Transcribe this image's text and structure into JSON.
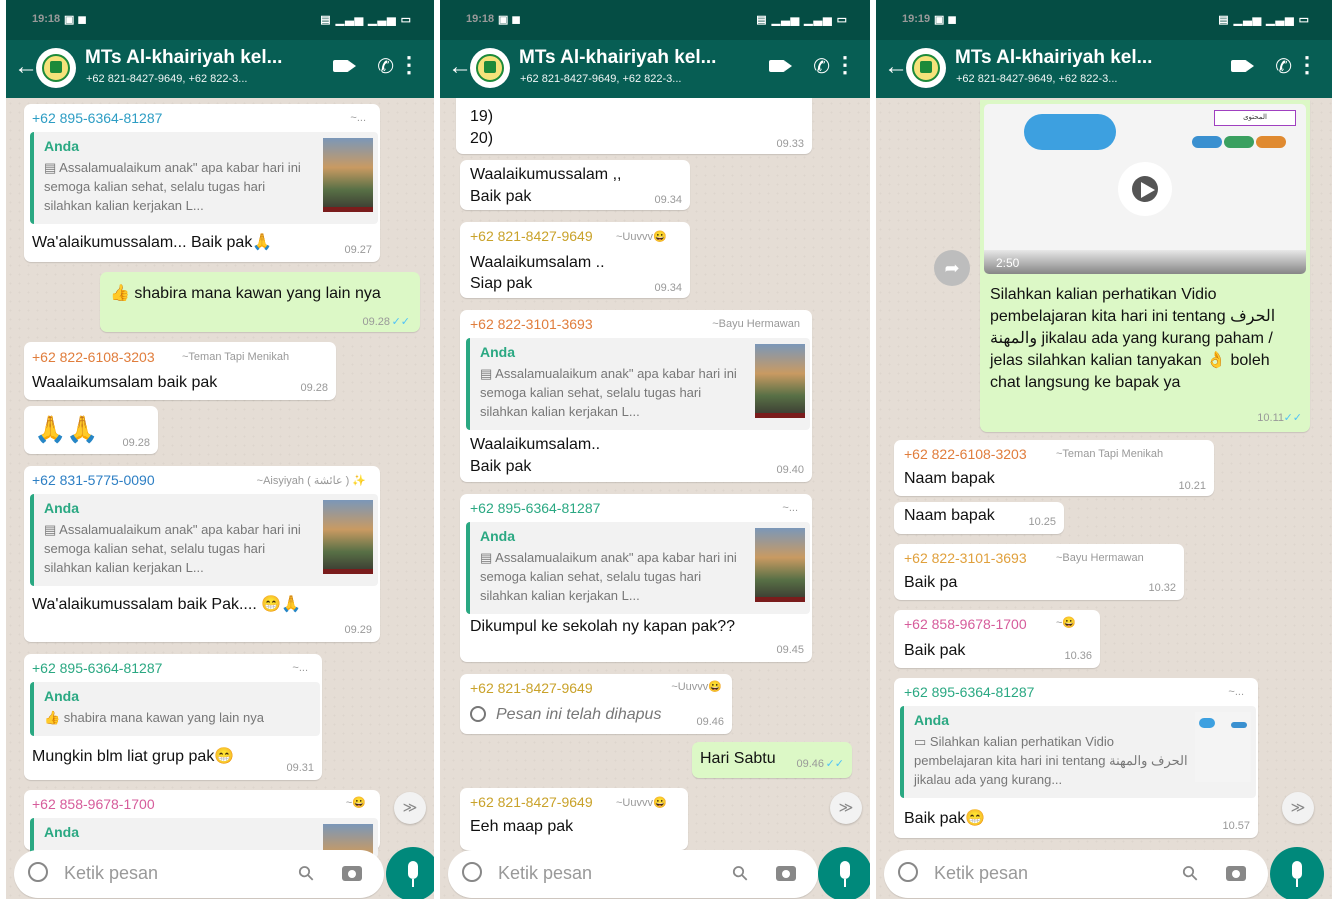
{
  "colors": {
    "statusbar": "#054d44",
    "appbar": "#075e54",
    "outgoing": "#dcf8c6",
    "incoming": "#ffffff",
    "accent": "#00897b",
    "read_checks": "#4fc3f7"
  },
  "chat": {
    "title": "MTs Al-khairiyah kel...",
    "subtitle": "+62 821-8427-9649, +62 822-3...",
    "input_placeholder": "Ketik pesan"
  },
  "icons": [
    "back-arrow-icon",
    "video-call-icon",
    "phone-icon",
    "more-options-icon",
    "emoji-icon",
    "attach-icon",
    "camera-icon",
    "mic-icon",
    "scroll-down-icon",
    "forward-icon",
    "play-icon"
  ],
  "p1": {
    "time": "19:18",
    "b1": {
      "sender": "+62 895-6364-81287",
      "tag": "~...",
      "qname": "Anda",
      "qtext": "▤ Assalamualaikum anak\" apa kabar hari ini semoga kalian sehat, selalu tugas hari silahkan kalian kerjakan L...",
      "text": "Wa'alaikumussalam... Baik pak🙏",
      "time": "09.27"
    },
    "b2": {
      "text": "👍 shabira mana kawan yang lain nya",
      "time": "09.28",
      "checks": "✓✓"
    },
    "b3": {
      "sender": "+62 822-6108-3203",
      "tag": "~Teman Tapi Menikah",
      "text": "Waalaikumsalam baik pak",
      "time": "09.28"
    },
    "b4": {
      "text": "🙏🙏",
      "time": "09.28"
    },
    "b5": {
      "sender": "+62 831-5775-0090",
      "tag": "~Aisyiyah ( عائشة ) ✨",
      "qname": "Anda",
      "qtext": "▤ Assalamualaikum anak\" apa kabar hari ini semoga kalian sehat, selalu tugas hari silahkan kalian kerjakan L...",
      "text": "Wa'alaikumussalam baik Pak.... 😁🙏",
      "time": "09.29"
    },
    "b6": {
      "sender": "+62 895-6364-81287",
      "tag": "~...",
      "qname": "Anda",
      "qtext": "👍 shabira mana kawan yang lain nya",
      "text": "Mungkin blm liat grup pak😁",
      "time": "09.31"
    },
    "b7": {
      "sender": "+62 858-9678-1700",
      "tag": "~😀",
      "qname": "Anda"
    }
  },
  "p2": {
    "time": "19:18",
    "b1": {
      "line1": "19)",
      "line2": "20)",
      "time": "09.33"
    },
    "b2": {
      "line1": "Waalaikumussalam ,,",
      "line2": "Baik pak",
      "time": "09.34"
    },
    "b3": {
      "sender": "+62 821-8427-9649",
      "tag": "~Uuvvv😀",
      "line1": "Waalaikumsalam ..",
      "line2": "Siap pak",
      "time": "09.34"
    },
    "b4": {
      "sender": "+62 822-3101-3693",
      "tag": "~Bayu Hermawan",
      "qname": "Anda",
      "qtext": "▤ Assalamualaikum anak\" apa kabar hari ini semoga kalian sehat, selalu tugas hari silahkan kalian kerjakan L...",
      "line1": "Waalaikumsalam..",
      "line2": "Baik pak",
      "time": "09.40"
    },
    "b5": {
      "sender": "+62 895-6364-81287",
      "tag": "~...",
      "qname": "Anda",
      "qtext": "▤ Assalamualaikum anak\" apa kabar hari ini semoga kalian sehat, selalu tugas hari silahkan kalian kerjakan L...",
      "text": "Dikumpul ke sekolah ny kapan pak??",
      "time": "09.45"
    },
    "b6": {
      "sender": "+62 821-8427-9649",
      "tag": "~Uuvvv😀",
      "text": "Pesan ini telah dihapus",
      "time": "09.46"
    },
    "b7": {
      "text": "Hari Sabtu",
      "time": "09.46",
      "checks": "✓✓"
    },
    "b8": {
      "sender": "+62 821-8427-9649",
      "tag": "~Uuvvv😀",
      "text": "Eeh maap pak"
    }
  },
  "p3": {
    "time": "19:19",
    "b1": {
      "video_duration": "2:50",
      "video_title": "المحتوى",
      "text": "Silahkan kalian perhatikan Vidio pembelajaran kita hari ini tentang الحرف والمهنة jikalau ada yang kurang paham / jelas silahkan kalian tanyakan 👌 boleh chat langsung ke bapak ya",
      "time": "10.11",
      "checks": "✓✓"
    },
    "b2": {
      "sender": "+62 822-6108-3203",
      "tag": "~Teman Tapi Menikah",
      "text": "Naam bapak",
      "time": "10.21"
    },
    "b3": {
      "text": "Naam bapak",
      "time": "10.25"
    },
    "b4": {
      "sender": "+62 822-3101-3693",
      "tag": "~Bayu Hermawan",
      "text": "Baik pa",
      "time": "10.32"
    },
    "b5": {
      "sender": "+62 858-9678-1700",
      "tag": "~😀",
      "text": "Baik pak",
      "time": "10.36"
    },
    "b6": {
      "sender": "+62 895-6364-81287",
      "tag": "~...",
      "qname": "Anda",
      "qtext": "▭ Silahkan kalian perhatikan Vidio pembelajaran kita hari ini tentang الحرف والمهنة jikalau ada yang kurang...",
      "text": "Baik pak😁",
      "time": "10.57"
    }
  }
}
